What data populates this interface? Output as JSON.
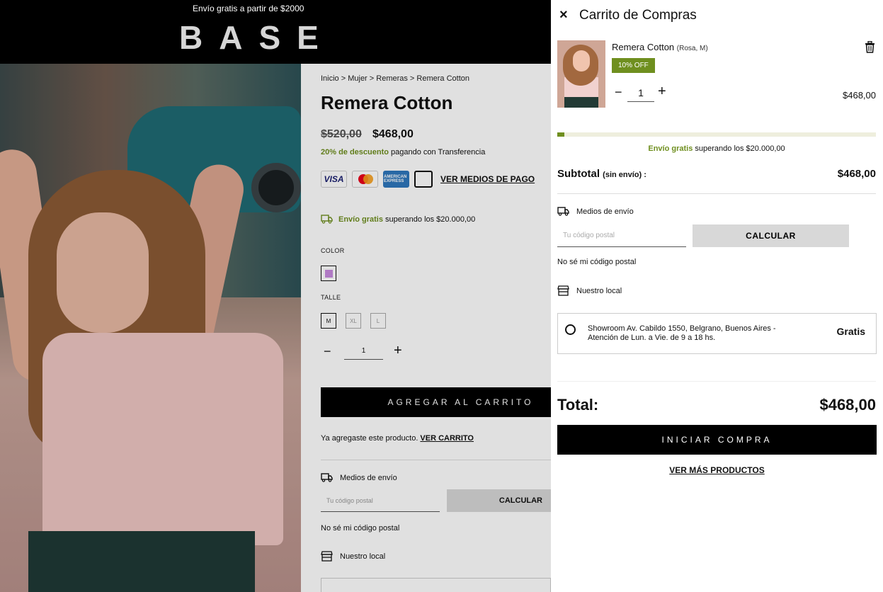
{
  "announcement": "Envío gratis a partir de $2000",
  "logo": "BASE",
  "product": {
    "breadcrumb": "Inicio > Mujer > Remeras > Remera Cotton",
    "title": "Remera Cotton",
    "old_price": "$520,00",
    "price": "$468,00",
    "discount_highlight": "20% de descuento",
    "discount_rest": " pagando con Transferencia",
    "cards": [
      "VISA",
      "mastercard",
      "AMERICAN EXPRESS",
      "generic-card"
    ],
    "payment_link": "VER MEDIOS DE PAGO",
    "shipping_highlight": "Envío gratis",
    "shipping_rest": " superando los $20.000,00",
    "color_label": "COLOR",
    "color_swatch": "#c98be0",
    "size_label": "TALLE",
    "sizes": [
      "M",
      "XL",
      "L"
    ],
    "quantity": "1",
    "add_button": "AGREGAR AL CARRITO",
    "added_text": "Ya agregaste este producto.",
    "view_cart": "VER CARRITO",
    "shipping_methods": "Medios de envío",
    "zip_placeholder": "Tu código postal",
    "calc_button": "CALCULAR",
    "no_zip": "No sé mi código postal",
    "local_store": "Nuestro local"
  },
  "cart": {
    "close_icon": "×",
    "title": "Carrito de Compras",
    "item": {
      "name": "Remera Cotton",
      "variant": "(Rosa, M)",
      "badge": "10% OFF",
      "quantity": "1",
      "price": "$468,00"
    },
    "progress_fraction": 0.023,
    "progress_color": "#6f8f1f",
    "free_ship_highlight": "Envío gratis",
    "free_ship_rest": " superando los $20.000,00",
    "subtotal_label": "Subtotal",
    "subtotal_note": "(sin envío) :",
    "subtotal_value": "$468,00",
    "shipping_methods": "Medios de envío",
    "zip_placeholder": "Tu código postal",
    "calc_button": "CALCULAR",
    "no_zip": "No sé mi código postal",
    "local_store": "Nuestro local",
    "store_text": "Showroom  Av. Cabildo 1550, Belgrano, Buenos Aires - Atención de Lun. a Vie. de 9 a 18 hs.",
    "store_price": "Gratis",
    "total_label": "Total:",
    "total_value": "$468,00",
    "buy_button": "INICIAR COMPRA",
    "more_products": "VER MÁS PRODUCTOS"
  }
}
